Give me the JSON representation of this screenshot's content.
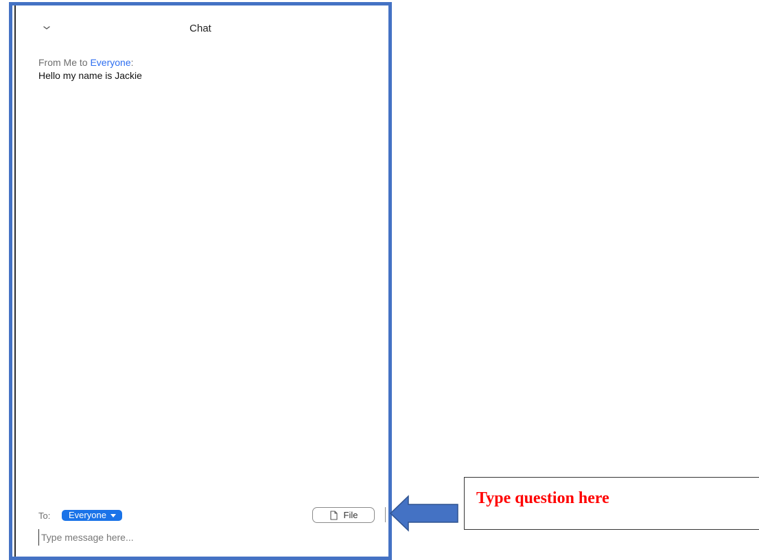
{
  "chat": {
    "title": "Chat",
    "messages": [
      {
        "header_prefix": "From Me to ",
        "recipient": "Everyone",
        "header_suffix": ":",
        "text": "Hello my name is Jackie"
      }
    ],
    "to_label": "To:",
    "to_value": "Everyone",
    "file_button_label": "File",
    "input_placeholder": "Type message here..."
  },
  "callout": {
    "text": "Type question here"
  },
  "colors": {
    "frame_border": "#4472c4",
    "accent_blue": "#1a73e8",
    "callout_text": "#ff0000"
  },
  "icons": [
    "chevron-down-icon",
    "dropdown-caret-icon",
    "file-icon",
    "arrow-left-icon"
  ]
}
